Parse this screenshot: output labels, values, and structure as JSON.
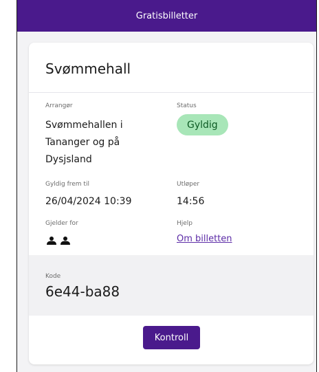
{
  "header": {
    "title": "Gratisbilletter"
  },
  "ticket": {
    "title": "Svømmehall",
    "organizer": {
      "label": "Arrangør",
      "value": "Svømmehallen i Tananger og på Dysjsland"
    },
    "status": {
      "label": "Status",
      "value": "Gyldig",
      "color": "#a8e6b8"
    },
    "valid_from": {
      "label": "Gyldig frem til",
      "value": "26/04/2024 10:39"
    },
    "expires": {
      "label": "Utløper",
      "value": "14:56"
    },
    "applies_for": {
      "label": "Gjelder for",
      "persons": 2,
      "icon": "person-icon"
    },
    "help": {
      "label": "Hjelp",
      "link": "Om billetten"
    },
    "code": {
      "label": "Kode",
      "value": "6e44-ba88"
    }
  },
  "actions": {
    "control_label": "Kontroll"
  },
  "colors": {
    "brand": "#4a1a8c",
    "link": "#5b2aa6"
  }
}
